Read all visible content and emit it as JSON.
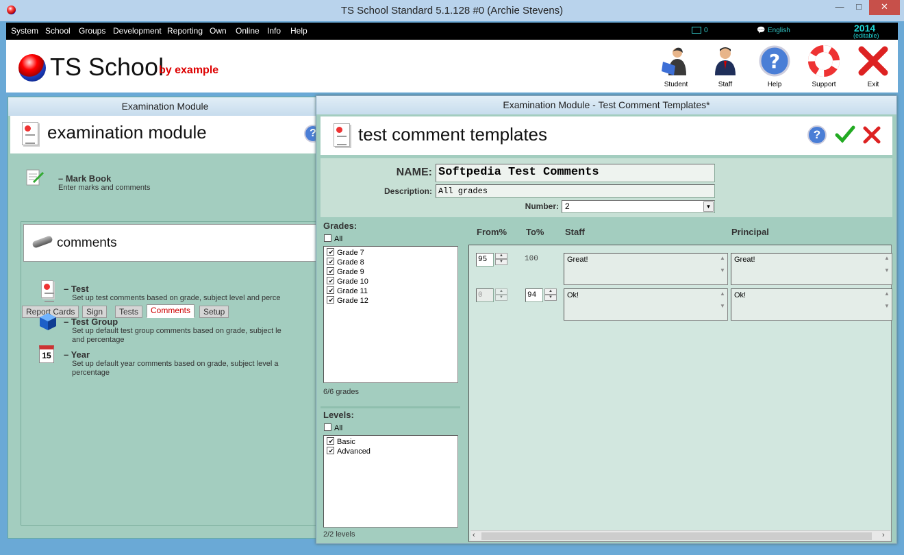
{
  "window": {
    "title": "TS School Standard 5.1.128 #0 (Archie Stevens)",
    "minimize": "—",
    "maximize": "□",
    "close": "✕"
  },
  "menu": {
    "items": [
      "System",
      "School",
      "Groups",
      "Development",
      "Reporting",
      "Own",
      "Online",
      "Info",
      "Help"
    ],
    "mail_count": "0",
    "language": "English",
    "year": "2014",
    "year_note": "(editable)"
  },
  "header": {
    "app_name": "TS School",
    "tagline": "by example",
    "toolbar": [
      {
        "label": "Student",
        "icon": "student-icon"
      },
      {
        "label": "Staff",
        "icon": "staff-icon"
      },
      {
        "label": "Help",
        "icon": "help-icon"
      },
      {
        "label": "Support",
        "icon": "lifebuoy-icon"
      },
      {
        "label": "Exit",
        "icon": "exit-icon"
      }
    ]
  },
  "left": {
    "caption": "Examination Module",
    "title": "examination module",
    "markbook": {
      "label": "– Mark Book",
      "desc": "Enter marks and comments"
    },
    "tabs": [
      "Report Cards",
      "Sign",
      "Tests",
      "Comments",
      "Setup"
    ],
    "active_tab": "Comments",
    "section_title": "comments",
    "items": [
      {
        "label": "– Test",
        "desc": "Set up test comments based on grade, subject level and perce",
        "icon": "document-icon"
      },
      {
        "label": "– Test Group",
        "desc": "Set up default test group comments based on grade, subject le",
        "desc2": "and percentage",
        "icon": "cube-icon"
      },
      {
        "label": "– Year",
        "desc": "Set up default year comments based on grade, subject level a",
        "desc2": "percentage",
        "icon": "calendar-icon",
        "day": "15"
      }
    ]
  },
  "right": {
    "caption": "Examination Module - Test Comment Templates*",
    "title": "test comment templates",
    "name_label": "NAME:",
    "name_value": "Softpedia Test Comments",
    "desc_label": "Description:",
    "desc_value": "All grades",
    "number_label": "Number:",
    "number_value": "2",
    "grades_label": "Grades:",
    "grades_all": "All",
    "grades": [
      "Grade 7",
      "Grade 8",
      "Grade 9",
      "Grade 10",
      "Grade 11",
      "Grade 12"
    ],
    "grades_count": "6/6 grades",
    "levels_label": "Levels:",
    "levels_all": "All",
    "levels": [
      "Basic",
      "Advanced"
    ],
    "levels_count": "2/2 levels",
    "columns": {
      "from": "From%",
      "to": "To%",
      "staff": "Staff",
      "principal": "Principal"
    },
    "rows": [
      {
        "from": "95",
        "to": "100",
        "staff": "Great!",
        "principal": "Great!"
      },
      {
        "from": "0",
        "to": "94",
        "staff": "Ok!",
        "principal": "Ok!"
      }
    ]
  },
  "colors": {
    "accent": "#c00000",
    "panel": "#a3cdbf",
    "menubar": "#000000"
  }
}
